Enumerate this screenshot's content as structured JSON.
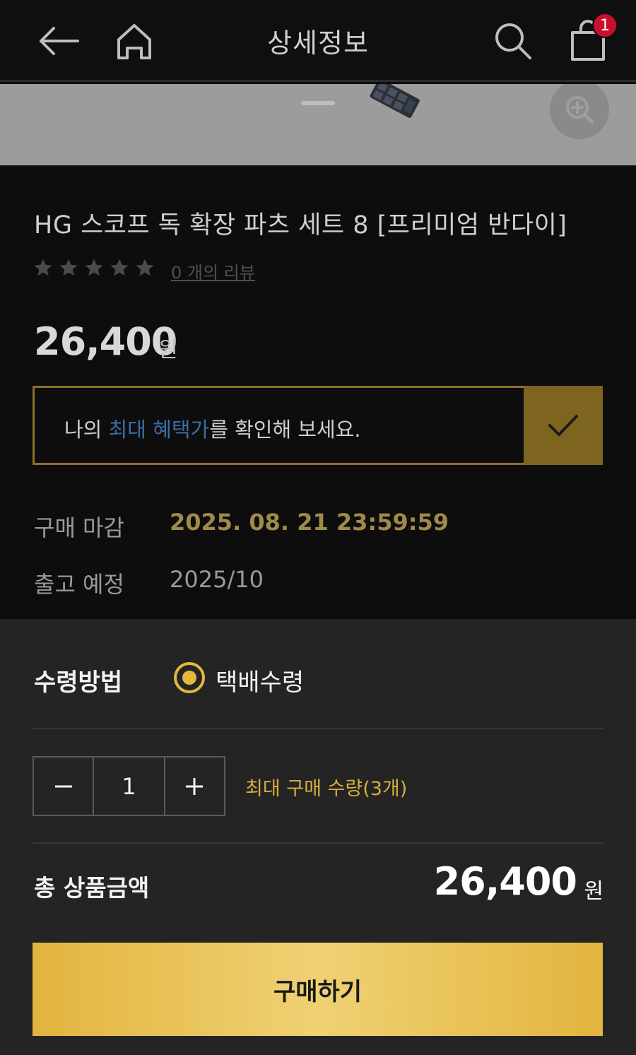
{
  "header": {
    "title": "상세정보",
    "cart_count": "1"
  },
  "product": {
    "title": "HG 스코프 독 확장 파츠 세트 8 [프리미엄 반다이]",
    "rating_stars": 5,
    "reviews_link": "0 개의 리뷰",
    "price": "26,400",
    "currency": "원"
  },
  "benefit": {
    "prefix": "나의 ",
    "highlight": "최대 혜택가",
    "suffix": "를 확인해 보세요."
  },
  "meta": {
    "deadline_label": "구매 마감",
    "deadline_value": "2025. 08. 21 23:59:59",
    "release_label": "출고 예정",
    "release_value": "2025/10"
  },
  "order": {
    "receive_label": "수령방법",
    "receive_option": "택배수령",
    "quantity": "1",
    "max_qty_note": "최대 구매 수량(3개)",
    "total_label": "총 상품금액",
    "total_price": "26,400",
    "currency": "원",
    "buy_label": "구매하기"
  },
  "colors": {
    "accent_gold": "#e3b43e",
    "deadline_gold": "#a08a4a",
    "badge_red": "#c8102e",
    "highlight_blue": "#3a6ea5"
  }
}
